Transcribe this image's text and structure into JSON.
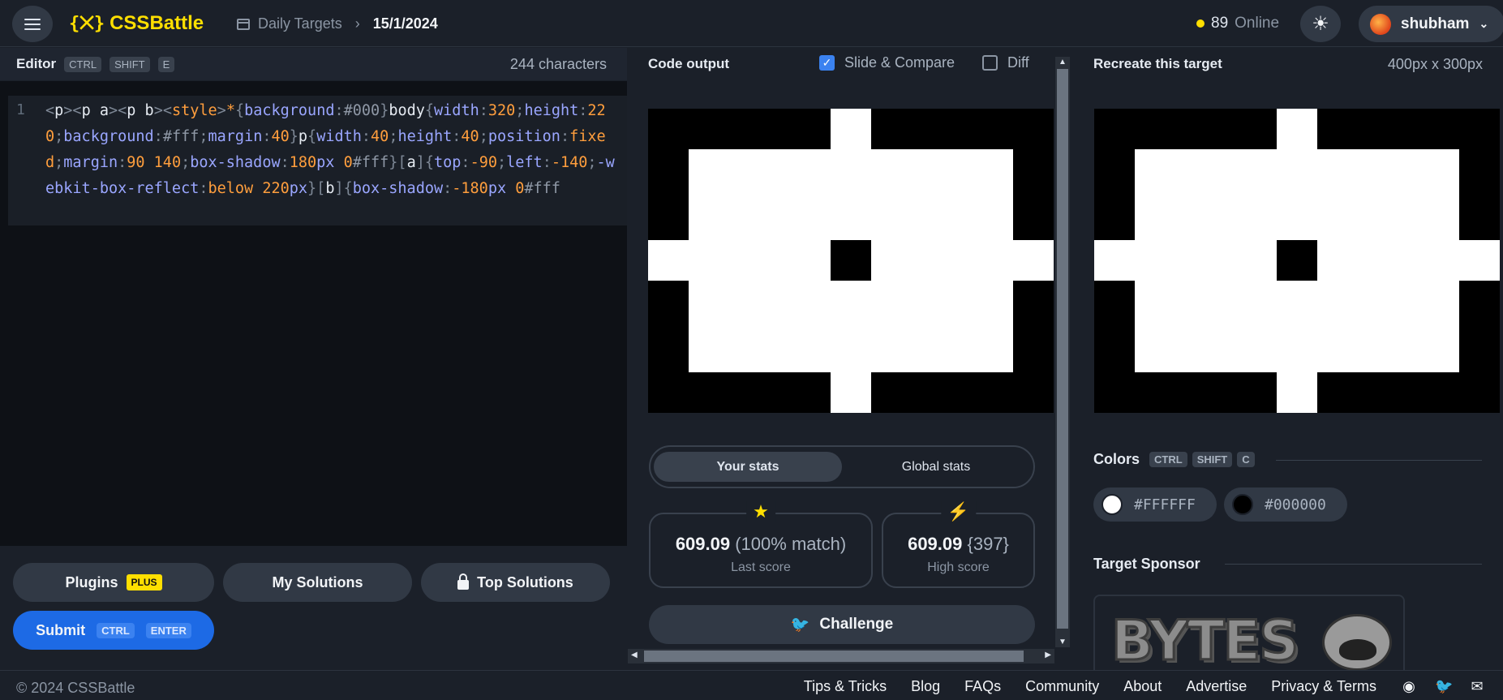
{
  "header": {
    "logo_text": "CSSBattle",
    "logo_mark": "{⨉}",
    "breadcrumb_section": "Daily Targets",
    "breadcrumb_date": "15/1/2024",
    "online_count": "89",
    "online_label": "Online",
    "username": "shubham"
  },
  "editor": {
    "title": "Editor",
    "shortcut": [
      "CTRL",
      "SHIFT",
      "E"
    ],
    "char_count": "244 characters",
    "line_number": "1",
    "tokens": [
      [
        "t-br",
        "<"
      ],
      [
        "t-tag",
        "p"
      ],
      [
        "t-br",
        "><"
      ],
      [
        "t-tag",
        "p a"
      ],
      [
        "t-br",
        "><"
      ],
      [
        "t-tag",
        "p b"
      ],
      [
        "t-br",
        "><"
      ],
      [
        "t-val",
        "style"
      ],
      [
        "t-br",
        ">"
      ],
      [
        "t-val",
        "*"
      ],
      [
        "t-br",
        "{"
      ],
      [
        "t-prop",
        "background"
      ],
      [
        "t-br",
        ":"
      ],
      [
        "t-dim",
        "#000"
      ],
      [
        "t-br",
        "}"
      ],
      [
        "t-sel",
        "body"
      ],
      [
        "t-br",
        "{"
      ],
      [
        "t-prop",
        "width"
      ],
      [
        "t-br",
        ":"
      ],
      [
        "t-val",
        "320"
      ],
      [
        "t-br",
        ";"
      ],
      [
        "t-prop",
        "height"
      ],
      [
        "t-br",
        ":"
      ],
      [
        "t-val",
        "220"
      ],
      [
        "t-br",
        ";"
      ],
      [
        "t-prop",
        "background"
      ],
      [
        "t-br",
        ":"
      ],
      [
        "t-dim",
        "#fff"
      ],
      [
        "t-br",
        ";"
      ],
      [
        "t-prop",
        "margin"
      ],
      [
        "t-br",
        ":"
      ],
      [
        "t-val",
        "40"
      ],
      [
        "t-br",
        "}"
      ],
      [
        "t-sel",
        "p"
      ],
      [
        "t-br",
        "{"
      ],
      [
        "t-prop",
        "width"
      ],
      [
        "t-br",
        ":"
      ],
      [
        "t-val",
        "40"
      ],
      [
        "t-br",
        ";"
      ],
      [
        "t-prop",
        "height"
      ],
      [
        "t-br",
        ":"
      ],
      [
        "t-val",
        "40"
      ],
      [
        "t-br",
        ";"
      ],
      [
        "t-prop",
        "position"
      ],
      [
        "t-br",
        ":"
      ],
      [
        "t-val",
        "fixed"
      ],
      [
        "t-br",
        ";"
      ],
      [
        "t-prop",
        "margin"
      ],
      [
        "t-br",
        ":"
      ],
      [
        "t-val",
        "90 140"
      ],
      [
        "t-br",
        ";"
      ],
      [
        "t-prop",
        "box-shadow"
      ],
      [
        "t-br",
        ":"
      ],
      [
        "t-val",
        "180"
      ],
      [
        "t-prop",
        "px"
      ],
      [
        "t-val",
        " 0"
      ],
      [
        "t-dim",
        "#fff"
      ],
      [
        "t-br",
        "}["
      ],
      [
        "t-sel",
        "a"
      ],
      [
        "t-br",
        "]{"
      ],
      [
        "t-prop",
        "top"
      ],
      [
        "t-br",
        ":"
      ],
      [
        "t-val",
        "-90"
      ],
      [
        "t-br",
        ";"
      ],
      [
        "t-prop",
        "left"
      ],
      [
        "t-br",
        ":"
      ],
      [
        "t-val",
        "-140"
      ],
      [
        "t-br",
        ";"
      ],
      [
        "t-prop",
        "-webkit-box-reflect"
      ],
      [
        "t-br",
        ":"
      ],
      [
        "t-val",
        "below 220"
      ],
      [
        "t-prop",
        "px"
      ],
      [
        "t-br",
        "}["
      ],
      [
        "t-sel",
        "b"
      ],
      [
        "t-br",
        "]{"
      ],
      [
        "t-prop",
        "box-shadow"
      ],
      [
        "t-br",
        ":"
      ],
      [
        "t-val",
        "-180"
      ],
      [
        "t-prop",
        "px"
      ],
      [
        "t-val",
        " 0"
      ],
      [
        "t-dim",
        "#fff"
      ]
    ]
  },
  "buttons": {
    "plugins": "Plugins",
    "plugins_badge": "PLUS",
    "my_solutions": "My Solutions",
    "top_solutions": "Top Solutions",
    "submit": "Submit",
    "submit_shortcut": [
      "CTRL",
      "ENTER"
    ]
  },
  "output": {
    "title": "Code output",
    "slide_compare": "Slide & Compare",
    "slide_compare_checked": true,
    "diff": "Diff",
    "diff_checked": false
  },
  "stats": {
    "tab_your": "Your stats",
    "tab_global": "Global stats",
    "last_score": "609.09",
    "last_detail": "(100% match)",
    "last_label": "Last score",
    "high_score": "609.09",
    "high_detail": "{397}",
    "high_label": "High score",
    "challenge": "Challenge"
  },
  "target": {
    "title": "Recreate this target",
    "dimensions": "400px x 300px",
    "colors_title": "Colors",
    "colors_shortcut": [
      "CTRL",
      "SHIFT",
      "C"
    ],
    "colors": [
      {
        "hex": "#FFFFFF",
        "swatch": "#ffffff"
      },
      {
        "hex": "#000000",
        "swatch": "#000000"
      }
    ],
    "sponsor_title": "Target Sponsor",
    "sponsor_logo_text": "BYTES"
  },
  "footer": {
    "copyright": "© 2024 CSSBattle",
    "links": [
      "Tips & Tricks",
      "Blog",
      "FAQs",
      "Community",
      "About",
      "Advertise",
      "Privacy & Terms"
    ],
    "social_icons": [
      "discord-icon",
      "twitter-icon",
      "mail-icon"
    ]
  },
  "colors": {
    "accent": "#ffdf00",
    "submit_blue": "#1d6ae5",
    "background": "#1b2029",
    "editor_bg": "#0e1116"
  }
}
